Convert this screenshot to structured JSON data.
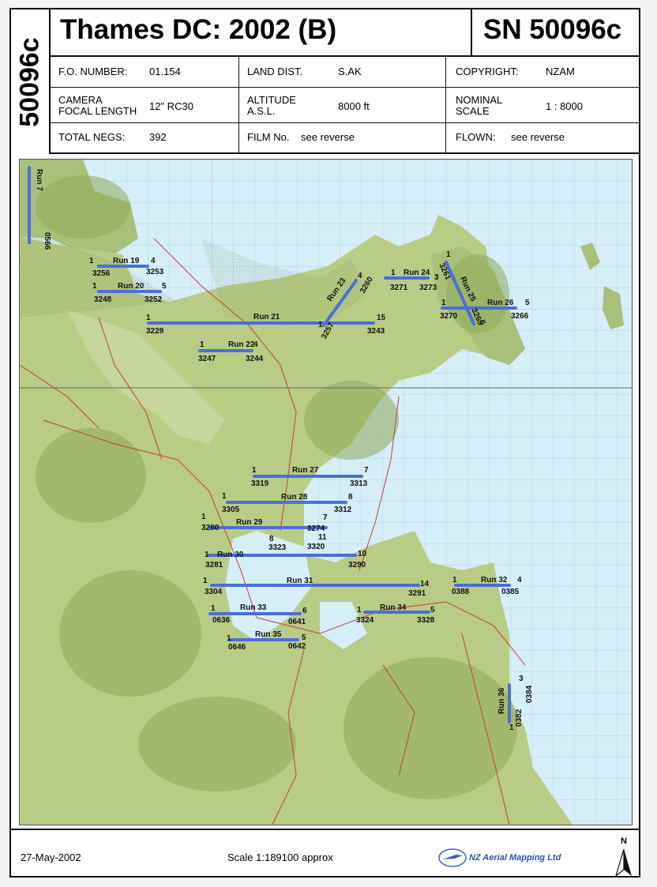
{
  "sidebar_code": "50096c",
  "title": "Thames DC: 2002 (B)",
  "sn": "SN 50096c",
  "fields": {
    "fo_label": "F.O. NUMBER:",
    "fo_value": "01.154",
    "land_label": "LAND DIST.",
    "land_value": "S.AK",
    "copy_label": "COPYRIGHT:",
    "copy_value": "NZAM",
    "camera_label1": "CAMERA",
    "camera_label2": "FOCAL LENGTH",
    "camera_value": "12\" RC30",
    "alt_label1": "ALTITUDE",
    "alt_label2": "A.S.L.",
    "alt_value": "8000 ft",
    "nominal_label1": "NOMINAL",
    "nominal_label2": "SCALE",
    "nominal_value": "1 : 8000",
    "negs_label": "TOTAL NEGS:",
    "negs_value": "392",
    "film_label": "FILM No.",
    "film_value": "see reverse",
    "flown_label": "FLOWN:",
    "flown_value": "see reverse"
  },
  "footer": {
    "date": "27-May-2002",
    "scale": "Scale  1:189100 approx",
    "company": "NZ Aerial Mapping Ltd",
    "north": "N"
  },
  "colors": {
    "run_line": "#4a6fd6",
    "sea": "#d6eef8",
    "land": "#b9cc86",
    "hills": "#8fa95a",
    "roads": "#c0392b"
  },
  "runs": [
    {
      "name": "Run 7",
      "start": "",
      "end": "0566",
      "labels": []
    },
    {
      "name": "Run 19",
      "start": "1",
      "end": "4",
      "labels": [
        "3256",
        "3253"
      ]
    },
    {
      "name": "Run 20",
      "start": "1",
      "end": "5",
      "labels": [
        "3248",
        "3252"
      ]
    },
    {
      "name": "Run 21",
      "start": "1",
      "end": "15",
      "labels": [
        "3229",
        "3243"
      ]
    },
    {
      "name": "Run 22",
      "start": "1",
      "end": "4",
      "labels": [
        "3247",
        "3244"
      ]
    },
    {
      "name": "Run 23",
      "start": "1",
      "end": "4",
      "labels": [
        "3257",
        "3260"
      ]
    },
    {
      "name": "Run 24",
      "start": "1",
      "end": "3",
      "labels": [
        "3271",
        "3273"
      ]
    },
    {
      "name": "Run 25",
      "start": "1",
      "end": "5",
      "labels": [
        "3261",
        "3265"
      ]
    },
    {
      "name": "Run 26",
      "start": "1",
      "end": "5",
      "labels": [
        "3270",
        "3266"
      ]
    },
    {
      "name": "Run 27",
      "start": "1",
      "end": "7",
      "labels": [
        "3319",
        "3313"
      ]
    },
    {
      "name": "Run 28",
      "start": "1",
      "end": "8",
      "labels": [
        "3305",
        "3312"
      ]
    },
    {
      "name": "Run 29",
      "start": "1",
      "end": "7",
      "labels": [
        "3280",
        "3274"
      ]
    },
    {
      "name": "Run 30",
      "start": "1",
      "end": "10",
      "labels": [
        "3281",
        "3290"
      ]
    },
    {
      "name": "Run 31",
      "start": "1",
      "end": "14",
      "labels": [
        "3304",
        "3291"
      ]
    },
    {
      "name": "Run 32",
      "start": "1",
      "end": "4",
      "labels": [
        "0388",
        "0385"
      ]
    },
    {
      "name": "Run 33",
      "start": "1",
      "end": "6",
      "labels": [
        "0636",
        "0641"
      ]
    },
    {
      "name": "Run 34",
      "start": "1",
      "end": "5",
      "labels": [
        "3324",
        "3328"
      ]
    },
    {
      "name": "Run 35",
      "start": "1",
      "end": "5",
      "labels": [
        "0646",
        "0642"
      ]
    },
    {
      "name": "Run 36",
      "start": "1",
      "end": "3",
      "labels": [
        "0382",
        "0384"
      ]
    }
  ],
  "extra_labels": {
    "l8": "8",
    "l3323": "3323",
    "l11": "11",
    "l3320": "3320"
  }
}
